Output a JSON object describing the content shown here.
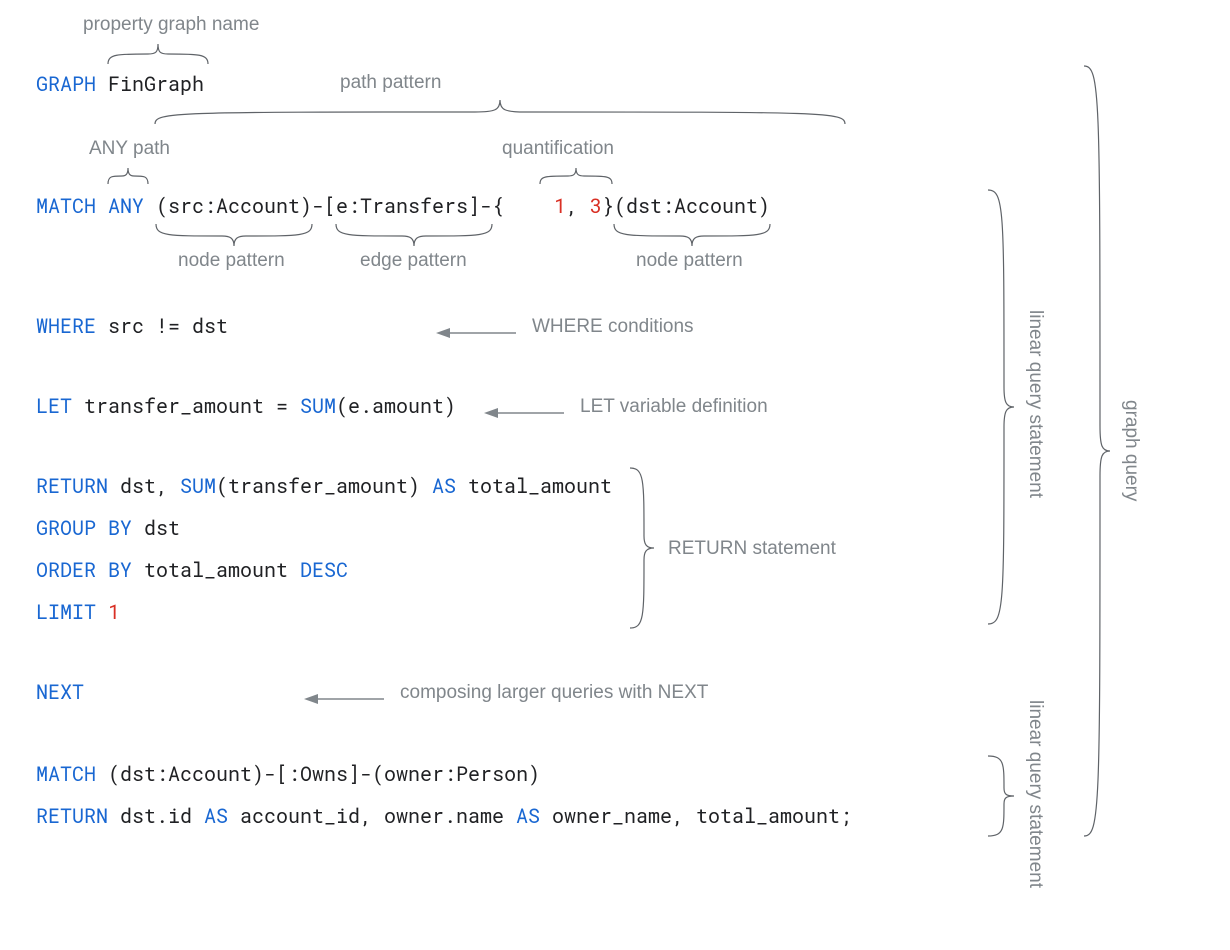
{
  "labels": {
    "property_graph_name": "property graph name",
    "path_pattern": "path pattern",
    "any_path": "ANY path",
    "quantification": "quantification",
    "node_pattern": "node pattern",
    "edge_pattern": "edge pattern",
    "where_conditions": "WHERE conditions",
    "let_variable_definition": "LET variable definition",
    "return_statement": "RETURN statement",
    "composing_next": "composing larger queries with NEXT",
    "linear_query_statement": "linear query statement",
    "graph_query": "graph query"
  },
  "code": {
    "graph_kw": "GRAPH",
    "graph_name": "FinGraph",
    "match_kw": "MATCH",
    "any_kw": "ANY",
    "src_open": "(src:Account)-[e:Transfers]-{",
    "num1": "1",
    "comma": ", ",
    "num3": "3",
    "close_quant": "}(dst:Account)",
    "where_kw": "WHERE",
    "where_body": "src != dst",
    "let_kw": "LET",
    "let_body1": "transfer_amount = ",
    "sum_kw": "SUM",
    "let_body2": "(e.amount)",
    "return_kw": "RETURN",
    "return_body1": "dst, ",
    "return_body2": "(transfer_amount) ",
    "as_kw": "AS",
    "return_body3": " total_amount",
    "group_by_kw": "GROUP BY",
    "group_by_body": "dst",
    "order_by_kw": "ORDER BY",
    "order_by_body": "total_amount ",
    "desc_kw": "DESC",
    "limit_kw": "LIMIT",
    "limit_val": "1",
    "next_kw": "NEXT",
    "match2_body": "(dst:Account)-[:Owns]-(owner:Person)",
    "return2_body1": "dst.id ",
    "return2_body2": " account_id, owner.name ",
    "return2_body3": " owner_name, total_amount;"
  }
}
